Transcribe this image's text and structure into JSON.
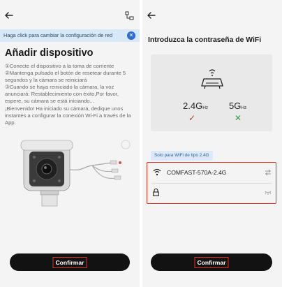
{
  "left": {
    "back_icon": "arrow-left-icon",
    "network_icon": "network-switch-icon",
    "notice": {
      "text": "Haga click para cambiar la configuración de red",
      "close_glyph": "✕"
    },
    "title": "Añadir dispositivo",
    "instructions": [
      "①Conecte el dispositivo a la toma de corriente",
      "②Mantenga pulsado el botón de resetear durante 5 segundos y la cámara se reiniciará",
      "③Cuando se haya reiniciado la cámara, la voz anunciará: Restablecimiento con éxito,Por favor, espere, su cámara se está iniciando...",
      "¡Bienvenido! Ha iniciado su cámara, dedique unos instantes a configurar la conexión Wi-Fi a través de la App."
    ],
    "confirm_label": "Confirmar"
  },
  "right": {
    "back_icon": "arrow-left-icon",
    "title": "Introduzca la contraseña de WiFi",
    "bands": {
      "b24": {
        "value": "2.4G",
        "unit": "Hz",
        "mark": "✓"
      },
      "b5": {
        "value": "5G",
        "unit": "Hz",
        "mark": "✕"
      }
    },
    "tag": "Solo para WiFi de tipo 2.4G",
    "ssid": "COMFAST-570A-2.4G",
    "password": {
      "value": "",
      "placeholder": ""
    },
    "confirm_label": "Confirmar"
  },
  "colors": {
    "accent": "#e0301e",
    "button": "#121212",
    "notice_bg": "#d7e8f7",
    "close": "#2e6bd6"
  }
}
